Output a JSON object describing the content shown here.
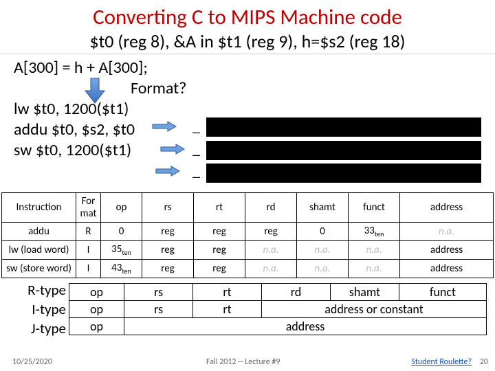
{
  "title": "Converting C to MIPS Machine code",
  "subtitle": "$t0 (reg 8), &A in $t1 (reg 9), h=$s2 (reg 18)",
  "body": {
    "c_stmt": "A[300] = h + A[300];",
    "format_q": "Format?",
    "instr1": "lw $t0, 1200($t1)",
    "instr2": "addu $t0, $s2, $t0",
    "instr3": "sw $t0, 1200($t1)",
    "blank": "_"
  },
  "cols": {
    "c0": "Instruction",
    "c1": "For mat",
    "c2": "op",
    "c3": "rs",
    "c4": "rt",
    "c5": "rd",
    "c6": "shamt",
    "c7": "funct",
    "c8": "address"
  },
  "rows": [
    {
      "instr": "addu",
      "fmt": "R",
      "op": "0",
      "rs": "reg",
      "rt": "reg",
      "rd": "reg",
      "shamt": "0",
      "funct": "33",
      "funct_sub": "ten",
      "addr": "n.a.",
      "addr_na": true,
      "rd_na": false,
      "shamt_na": false,
      "funct_na": false
    },
    {
      "instr": "lw (load word)",
      "fmt": "I",
      "op": "35",
      "op_sub": "ten",
      "rs": "reg",
      "rt": "reg",
      "rd": "n.a.",
      "rd_na": true,
      "shamt": "n.a.",
      "shamt_na": true,
      "funct": "n.a.",
      "funct_na": true,
      "addr": "address",
      "addr_na": false
    },
    {
      "instr": "sw (store word)",
      "fmt": "I",
      "op": "43",
      "op_sub": "ten",
      "rs": "reg",
      "rt": "reg",
      "rd": "n.a.",
      "rd_na": true,
      "shamt": "n.a.",
      "shamt_na": true,
      "funct": "n.a.",
      "funct_na": true,
      "addr": "address",
      "addr_na": false
    }
  ],
  "fmt_labels": {
    "r": "R-type",
    "i": "I-type",
    "j": "J-type"
  },
  "fmt_rows": {
    "r": {
      "op": "op",
      "rs": "rs",
      "rt": "rt",
      "rd": "rd",
      "shamt": "shamt",
      "funct": "funct"
    },
    "i": {
      "op": "op",
      "rs": "rs",
      "rt": "rt",
      "rest": "address or constant"
    },
    "j": {
      "op": "op",
      "rest": "address"
    }
  },
  "footer": {
    "date": "10/25/2020",
    "mid": "Fall 2012 -- Lecture #9",
    "link": "Student Roulette?",
    "page": "20"
  }
}
